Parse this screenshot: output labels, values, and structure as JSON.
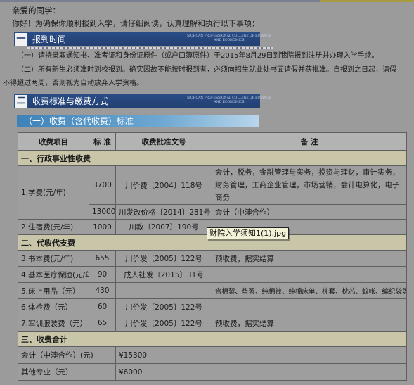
{
  "greeting": "亲爱的同学：",
  "intro": "你好！为确保你顺利报到入学，请仔细阅读，认真理解和执行以下事项：",
  "section1": {
    "num": "一",
    "title": "报到时间",
    "eng": "SICHUAN PROFESSIONAL COLLEGE OF FINANCE AND ECONOMICS",
    "p1": "（一）请持录取通知书、准考证和身份证原件（或户口簿原件）于2015年8月29日到我院报到注册并办理入学手续。",
    "p2a": "（二）所有新生必须准时到校报到。确实因故不能按时报到者，必须向招生就业处书面请假并获批准。自报到之日起，请假",
    "p2b": "不得超过两周，否则视为自动放弃入学资格。"
  },
  "section2": {
    "num": "二",
    "title": "收费标准与缴费方式",
    "eng": "SICHUAN PROFESSIONAL COLLEGE OF FINANCE AND ECONOMICS",
    "sub": "（一）收费（含代收费）标准"
  },
  "table": {
    "headers": {
      "item": "收费项目",
      "std": "标 准",
      "doc": "收费批准文号",
      "note": "备 注"
    },
    "cat1": "一、行政事业性收费",
    "tuition": {
      "item": "1.学费(元/年)",
      "std1": "3700",
      "doc1": "川价费〔2004〕118号",
      "note1": "会计，税务，金融管理与实务，投资与理财，审计实务，财务管理，工商企业管理，市场营销，会计电算化，电子商务",
      "std2": "13000",
      "doc2": "川发改价格〔2014〕281号",
      "note2": "会计（中澳合作）"
    },
    "lodging": {
      "item": "2.住宿费(元/年)",
      "std": "1000",
      "doc": "川教〔2007〕190号",
      "note": ""
    },
    "cat2": "二、代收代支费",
    "books": {
      "item": "3.书本费(元/年)",
      "std": "655",
      "doc": "川价发〔2005〕122号",
      "note": "预收费，据实结算"
    },
    "medical": {
      "item": "4.基本医疗保险(元/年)",
      "std": "90",
      "doc": "成人社发〔2015〕31号",
      "note": ""
    },
    "bedding": {
      "item": "5.床上用品（元）",
      "std": "430",
      "doc": "",
      "note": "含棉絮、垫絮、纯棉被、纯棉床单、枕套、枕芯、蚊帐、编织袋等"
    },
    "exam": {
      "item": "6.体检费（元）",
      "std": "60",
      "doc": "川价发〔2005〕122号",
      "note": ""
    },
    "uniform": {
      "item": "7.军训服装费（元）",
      "std": "65",
      "doc": "川价发〔2005〕122号",
      "note": "预收费，据实结算"
    },
    "cat3": "三、收费合计",
    "total1": {
      "item": "会计（中澳合作）(元)",
      "amount": "¥15300"
    },
    "total2": {
      "item": "其他专业（元）",
      "amount": "¥6000"
    }
  },
  "tooltip": "财院入学须知1(1).jpg"
}
